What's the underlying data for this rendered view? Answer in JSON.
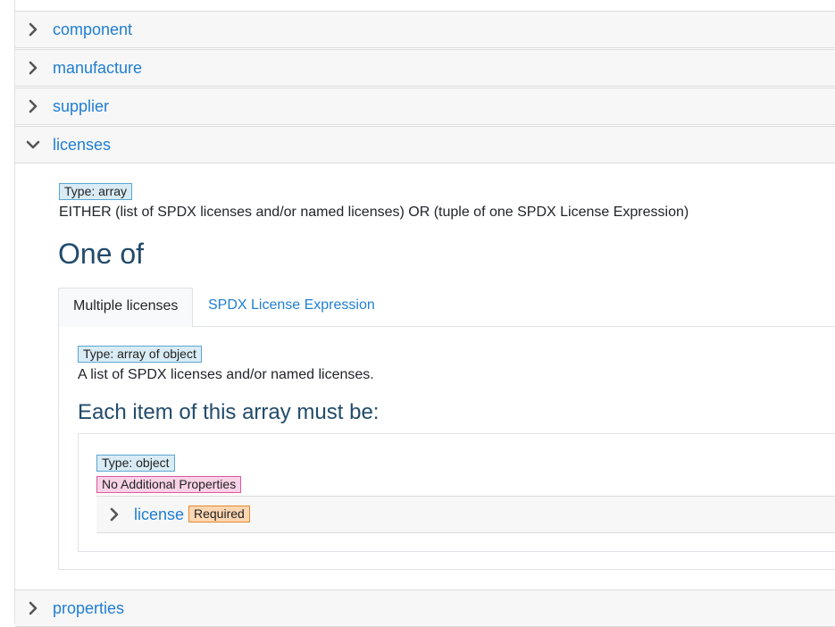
{
  "accordion": {
    "items": [
      {
        "label": "component",
        "expanded": false
      },
      {
        "label": "manufacture",
        "expanded": false
      },
      {
        "label": "supplier",
        "expanded": false
      },
      {
        "label": "licenses",
        "expanded": true
      },
      {
        "label": "properties",
        "expanded": false
      }
    ]
  },
  "licenses": {
    "type_badge": "Type: array",
    "description": "EITHER (list of SPDX licenses and/or named licenses) OR (tuple of one SPDX License Expression)",
    "one_of_heading": "One of",
    "tabs": [
      {
        "label": "Multiple licenses",
        "active": true
      },
      {
        "label": "SPDX License Expression",
        "active": false
      }
    ],
    "pane": {
      "type_badge": "Type: array of object",
      "description": "A list of SPDX licenses and/or named licenses.",
      "items_heading": "Each item of this array must be:",
      "item": {
        "type_badge": "Type: object",
        "no_props_badge": "No Additional Properties",
        "property": {
          "label": "license",
          "required_badge": "Required"
        }
      }
    }
  },
  "colors": {
    "link": "#1f7ed1",
    "heading": "#224b6b",
    "type_badge_bg": "#d9ecf6",
    "no_props_badge_bg": "#f8d2e6",
    "required_badge_bg": "#fbd6b3"
  },
  "icons": {
    "collapsed": "chevron-right-icon",
    "expanded": "chevron-down-icon"
  }
}
